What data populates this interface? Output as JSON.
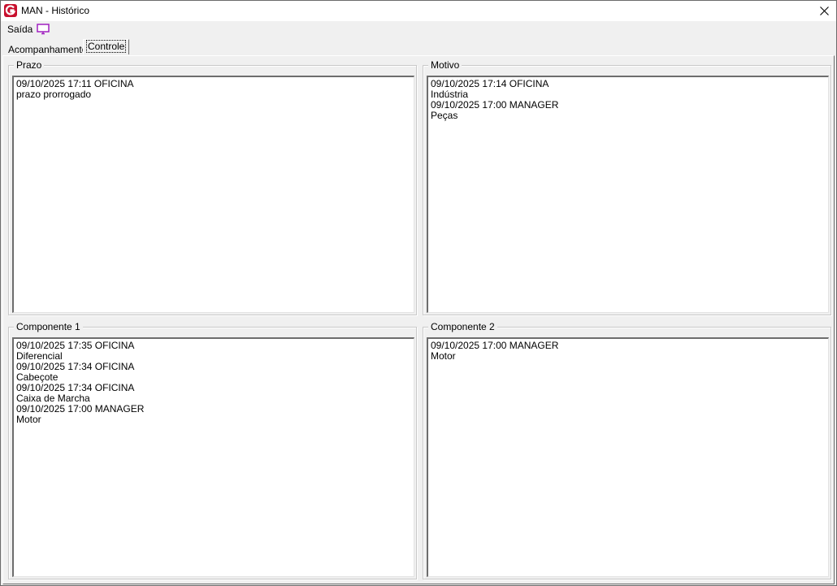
{
  "window": {
    "title": "MAN - Histórico"
  },
  "menu": {
    "saida_label": "Saída",
    "monitor_icon": "monitor-icon",
    "monitor_color": "#a020c0"
  },
  "tabs": [
    {
      "label": "Acompanhamento",
      "selected": false
    },
    {
      "label": "Controle",
      "selected": true
    }
  ],
  "groups": {
    "prazo": {
      "label": "Prazo",
      "lines": [
        "09/10/2025 17:11 OFICINA",
        "prazo prorrogado"
      ]
    },
    "motivo": {
      "label": "Motivo",
      "lines": [
        "09/10/2025 17:14 OFICINA",
        "Indústria",
        "09/10/2025 17:00 MANAGER",
        "Peças"
      ]
    },
    "componente1": {
      "label": "Componente 1",
      "lines": [
        "09/10/2025 17:35 OFICINA",
        "Diferencial",
        "09/10/2025 17:34 OFICINA",
        "Cabeçote",
        "09/10/2025 17:34 OFICINA",
        "Caixa de Marcha",
        "09/10/2025 17:00 MANAGER",
        "Motor"
      ]
    },
    "componente2": {
      "label": "Componente 2",
      "lines": [
        "09/10/2025 17:00 MANAGER",
        "Motor"
      ]
    }
  },
  "colors": {
    "app_icon": "#c8102e"
  }
}
